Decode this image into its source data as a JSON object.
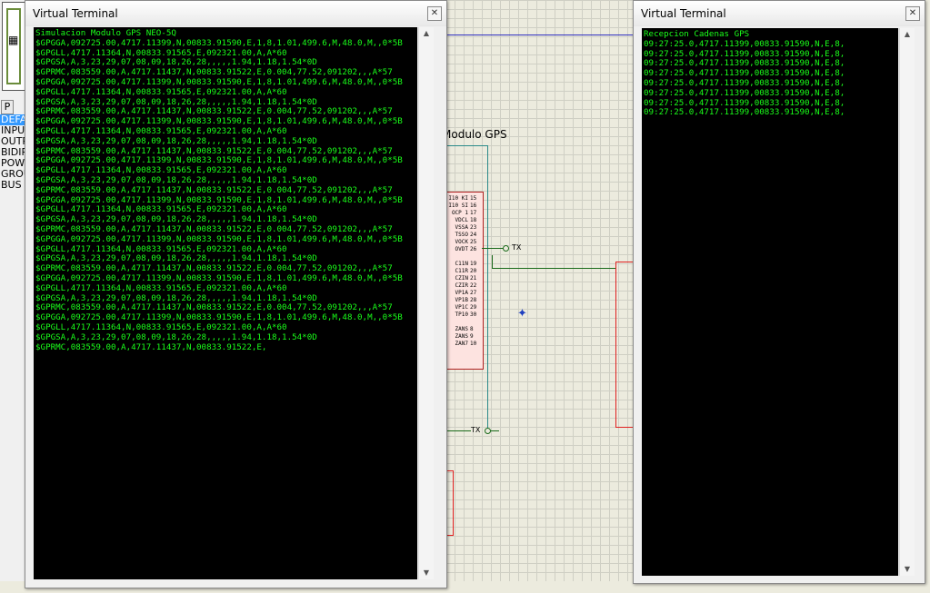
{
  "left_panel": {
    "p_button": "P",
    "modes": [
      {
        "label": "DEFAULT",
        "selected": true
      },
      {
        "label": "INPUT",
        "selected": false
      },
      {
        "label": "OUTPUT",
        "selected": false
      },
      {
        "label": "BIDIR",
        "selected": false
      },
      {
        "label": "POWER",
        "selected": false
      },
      {
        "label": "GROUND",
        "selected": false
      },
      {
        "label": "BUS",
        "selected": false
      }
    ]
  },
  "schematic": {
    "gps_label": "Modulo GPS",
    "tx_label_1": "TX",
    "tx_label_2": "TX",
    "ic_pin_labels": [
      "I10 KI",
      "I10 SI",
      "OCP 1",
      "VDCL",
      "VSSA",
      "TSSO",
      "VOCK",
      "OVDT",
      "",
      "C11N",
      "C11R",
      "CZIN",
      "CZIR",
      "VP1A",
      "VP1B",
      "VP1C",
      "TP10",
      "",
      "ZANS",
      "ZANS",
      "ZAN7"
    ],
    "ic_pin_numbers": [
      "15",
      "16",
      "17",
      "18",
      "23",
      "24",
      "25",
      "26",
      "",
      "19",
      "20",
      "21",
      "22",
      "27",
      "28",
      "29",
      "30",
      "",
      "8",
      "9",
      "10"
    ]
  },
  "terminal_left": {
    "title": "Virtual Terminal",
    "lines": [
      "Simulacion Modulo GPS NEO-5Q",
      "$GPGGA,092725.00,4717.11399,N,00833.91590,E,1,8,1.01,499.6,M,48.0,M,,0*5B",
      "$GPGLL,4717.11364,N,00833.91565,E,092321.00,A,A*60",
      "$GPGSA,A,3,23,29,07,08,09,18,26,28,,,,,1.94,1.18,1.54*0D",
      "$GPRMC,083559.00,A,4717.11437,N,00833.91522,E,0.004,77.52,091202,,,A*57",
      "$GPGGA,092725.00,4717.11399,N,00833.91590,E,1,8,1.01,499.6,M,48.0,M,,0*5B",
      "$GPGLL,4717.11364,N,00833.91565,E,092321.00,A,A*60",
      "$GPGSA,A,3,23,29,07,08,09,18,26,28,,,,,1.94,1.18,1.54*0D",
      "$GPRMC,083559.00,A,4717.11437,N,00833.91522,E,0.004,77.52,091202,,,A*57",
      "$GPGGA,092725.00,4717.11399,N,00833.91590,E,1,8,1.01,499.6,M,48.0,M,,0*5B",
      "$GPGLL,4717.11364,N,00833.91565,E,092321.00,A,A*60",
      "$GPGSA,A,3,23,29,07,08,09,18,26,28,,,,,1.94,1.18,1.54*0D",
      "$GPRMC,083559.00,A,4717.11437,N,00833.91522,E,0.004,77.52,091202,,,A*57",
      "$GPGGA,092725.00,4717.11399,N,00833.91590,E,1,8,1.01,499.6,M,48.0,M,,0*5B",
      "$GPGLL,4717.11364,N,00833.91565,E,092321.00,A,A*60",
      "$GPGSA,A,3,23,29,07,08,09,18,26,28,,,,,1.94,1.18,1.54*0D",
      "$GPRMC,083559.00,A,4717.11437,N,00833.91522,E,0.004,77.52,091202,,,A*57",
      "$GPGGA,092725.00,4717.11399,N,00833.91590,E,1,8,1.01,499.6,M,48.0,M,,0*5B",
      "$GPGLL,4717.11364,N,00833.91565,E,092321.00,A,A*60",
      "$GPGSA,A,3,23,29,07,08,09,18,26,28,,,,,1.94,1.18,1.54*0D",
      "$GPRMC,083559.00,A,4717.11437,N,00833.91522,E,0.004,77.52,091202,,,A*57",
      "$GPGGA,092725.00,4717.11399,N,00833.91590,E,1,8,1.01,499.6,M,48.0,M,,0*5B",
      "$GPGLL,4717.11364,N,00833.91565,E,092321.00,A,A*60",
      "$GPGSA,A,3,23,29,07,08,09,18,26,28,,,,,1.94,1.18,1.54*0D",
      "$GPRMC,083559.00,A,4717.11437,N,00833.91522,E,0.004,77.52,091202,,,A*57",
      "$GPGGA,092725.00,4717.11399,N,00833.91590,E,1,8,1.01,499.6,M,48.0,M,,0*5B",
      "$GPGLL,4717.11364,N,00833.91565,E,092321.00,A,A*60",
      "$GPGSA,A,3,23,29,07,08,09,18,26,28,,,,,1.94,1.18,1.54*0D",
      "$GPRMC,083559.00,A,4717.11437,N,00833.91522,E,0.004,77.52,091202,,,A*57",
      "$GPGGA,092725.00,4717.11399,N,00833.91590,E,1,8,1.01,499.6,M,48.0,M,,0*5B",
      "$GPGLL,4717.11364,N,00833.91565,E,092321.00,A,A*60",
      "$GPGSA,A,3,23,29,07,08,09,18,26,28,,,,,1.94,1.18,1.54*0D",
      "$GPRMC,083559.00,A,4717.11437,N,00833.91522,E,"
    ]
  },
  "terminal_right": {
    "title": "Virtual Terminal",
    "lines": [
      "Recepcion Cadenas GPS",
      "09:27:25.0,4717.11399,00833.91590,N,E,8,",
      "09:27:25.0,4717.11399,00833.91590,N,E,8,",
      "09:27:25.0,4717.11399,00833.91590,N,E,8,",
      "09:27:25.0,4717.11399,00833.91590,N,E,8,",
      "09:27:25.0,4717.11399,00833.91590,N,E,8,",
      "09:27:25.0,4717.11399,00833.91590,N,E,8,",
      "09:27:25.0,4717.11399,00833.91590,N,E,8,",
      "09:27:25.0,4717.11399,00833.91590,N,E,8,"
    ]
  },
  "icons": {
    "close": "close-icon",
    "scroll_up": "scroll-up-arrow-icon",
    "scroll_down": "scroll-down-arrow-icon",
    "cursor": "crosshair-cursor-icon",
    "component": "component-symbol-icon"
  },
  "colors": {
    "terminal_bg": "#000000",
    "terminal_text": "#1aff1a",
    "canvas_bg": "#ecebde",
    "ic_border": "#b02020",
    "wire": "#2a8a8a",
    "selection": "#3399ff"
  }
}
